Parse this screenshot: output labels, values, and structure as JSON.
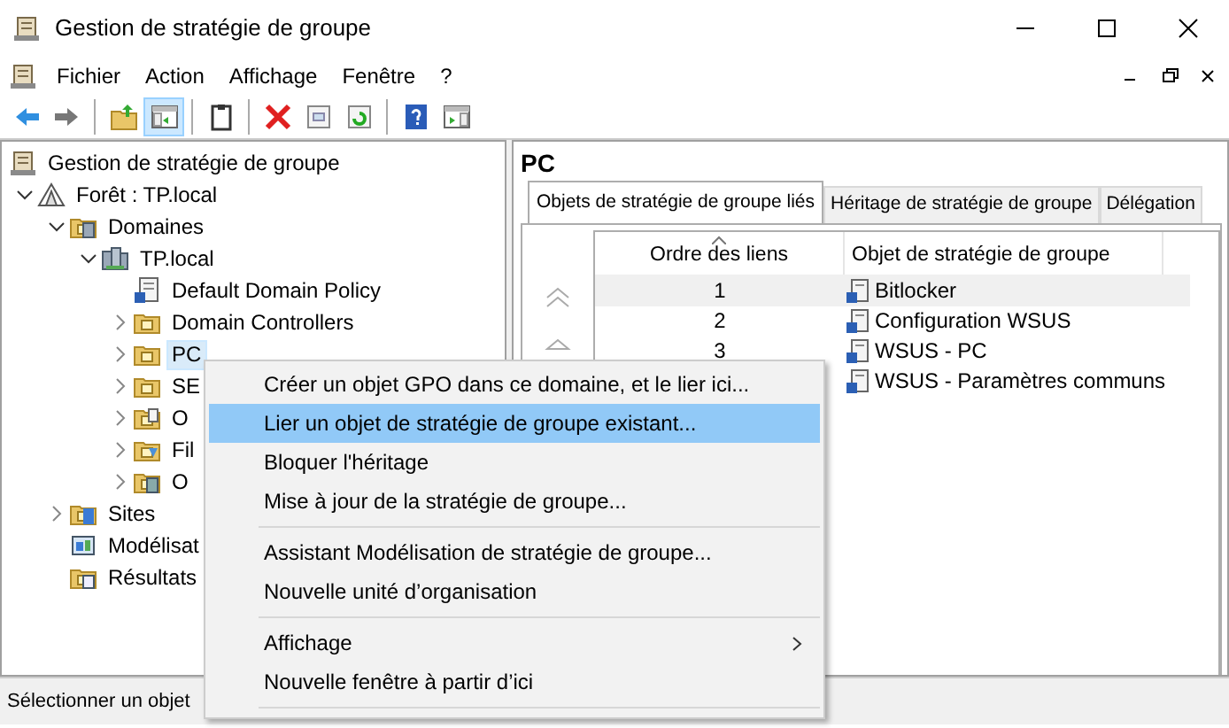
{
  "window": {
    "title": "Gestion de stratégie de groupe"
  },
  "menu_bar": [
    "Fichier",
    "Action",
    "Affichage",
    "Fenêtre",
    "?"
  ],
  "toolbar": [
    {
      "kind": "back",
      "selected": false
    },
    {
      "kind": "forward",
      "selected": false
    },
    {
      "kind": "separator"
    },
    {
      "kind": "up",
      "selected": false
    },
    {
      "kind": "tree",
      "selected": true
    },
    {
      "kind": "separator"
    },
    {
      "kind": "clipboard",
      "selected": false
    },
    {
      "kind": "separator"
    },
    {
      "kind": "delete",
      "selected": false
    },
    {
      "kind": "properties",
      "selected": false
    },
    {
      "kind": "refresh",
      "selected": false
    },
    {
      "kind": "separator"
    },
    {
      "kind": "help",
      "selected": false
    },
    {
      "kind": "pane",
      "selected": false
    }
  ],
  "tree": {
    "label": "Gestion de stratégie de groupe",
    "kind": "console",
    "selected": false,
    "children": [
      {
        "label": "Forêt : TP.local",
        "kind": "forest",
        "expanded": true,
        "selected": false,
        "children": [
          {
            "label": "Domaines",
            "kind": "domains",
            "expanded": true,
            "selected": false,
            "children": [
              {
                "label": "TP.local",
                "kind": "domain",
                "expanded": true,
                "selected": false,
                "children": [
                  {
                    "label": "Default Domain Policy",
                    "kind": "gpo",
                    "selected": false
                  },
                  {
                    "label": "Domain Controllers",
                    "kind": "ou",
                    "expanded": false,
                    "selected": false
                  },
                  {
                    "label": "PC",
                    "kind": "ou",
                    "expanded": false,
                    "selected": true
                  },
                  {
                    "label": "SE",
                    "kind": "ou",
                    "expanded": false,
                    "selected": false
                  },
                  {
                    "label": "O",
                    "kind": "gpo-folder",
                    "expanded": false,
                    "selected": false
                  },
                  {
                    "label": "Fil",
                    "kind": "wmi",
                    "expanded": false,
                    "selected": false
                  },
                  {
                    "label": "O",
                    "kind": "starter",
                    "expanded": false,
                    "selected": false
                  }
                ]
              }
            ]
          },
          {
            "label": "Sites",
            "kind": "sites",
            "expanded": false,
            "selected": false
          },
          {
            "label": "Modélisat",
            "kind": "modeling",
            "selected": false
          },
          {
            "label": "Résultats",
            "kind": "results",
            "selected": false
          }
        ]
      }
    ]
  },
  "details": {
    "title": "PC",
    "tabs": [
      {
        "label": "Objets de stratégie de groupe liés",
        "selected": true
      },
      {
        "label": "Héritage de stratégie de groupe",
        "selected": false
      },
      {
        "label": "Délégation",
        "selected": false
      }
    ],
    "columns": [
      {
        "label": "Ordre des liens",
        "sorted": true
      },
      {
        "label": "Objet de stratégie de groupe",
        "sorted": false
      }
    ],
    "rows": [
      {
        "order": "1",
        "name": "Bitlocker",
        "selected": true
      },
      {
        "order": "2",
        "name": "Configuration WSUS",
        "selected": false
      },
      {
        "order": "3",
        "name": "WSUS - PC",
        "selected": false
      },
      {
        "name": "WSUS - Paramètres communs",
        "selected": false
      }
    ]
  },
  "context_menu": [
    {
      "kind": "item",
      "label": "Créer un objet GPO dans ce domaine, et le lier ici...",
      "selected": false
    },
    {
      "kind": "item",
      "label": "Lier un objet de stratégie de groupe existant...",
      "selected": true
    },
    {
      "kind": "item",
      "label": "Bloquer l'héritage",
      "selected": false
    },
    {
      "kind": "item",
      "label": "Mise à jour de la stratégie de groupe...",
      "selected": false
    },
    {
      "kind": "separator"
    },
    {
      "kind": "item",
      "label": "Assistant Modélisation de stratégie de groupe...",
      "selected": false
    },
    {
      "kind": "item",
      "label": "Nouvelle unité d’organisation",
      "selected": false
    },
    {
      "kind": "separator"
    },
    {
      "kind": "item",
      "label": "Affichage",
      "selected": false,
      "submenu": true
    },
    {
      "kind": "item",
      "label": "Nouvelle fenêtre à partir d’ici",
      "selected": false
    },
    {
      "kind": "separator"
    }
  ],
  "status_bar": "Sélectionner un objet"
}
